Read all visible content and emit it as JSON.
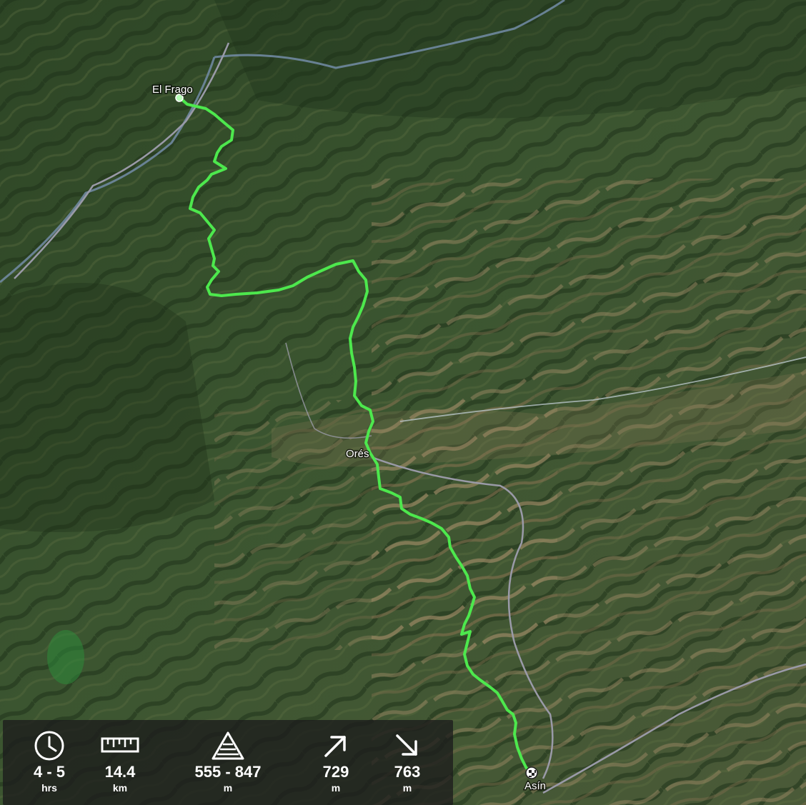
{
  "map": {
    "view": "3d-satellite-terrain",
    "places": [
      "El Frago",
      "Orés",
      "Asín"
    ],
    "route_color": "#4de84d",
    "start_marker_icon": "start-dot-icon",
    "finish_marker_icon": "finish-flag-icon"
  },
  "stats": [
    {
      "icon": "clock-icon",
      "value": "4 - 5",
      "unit": "hrs"
    },
    {
      "icon": "ruler-icon",
      "value": "14.4",
      "unit": "km"
    },
    {
      "icon": "elevation-icon",
      "value": "555 - 847",
      "unit": "m"
    },
    {
      "icon": "ascent-arrow-icon",
      "value": "729",
      "unit": "m"
    },
    {
      "icon": "descent-arrow-icon",
      "value": "763",
      "unit": "m"
    }
  ]
}
